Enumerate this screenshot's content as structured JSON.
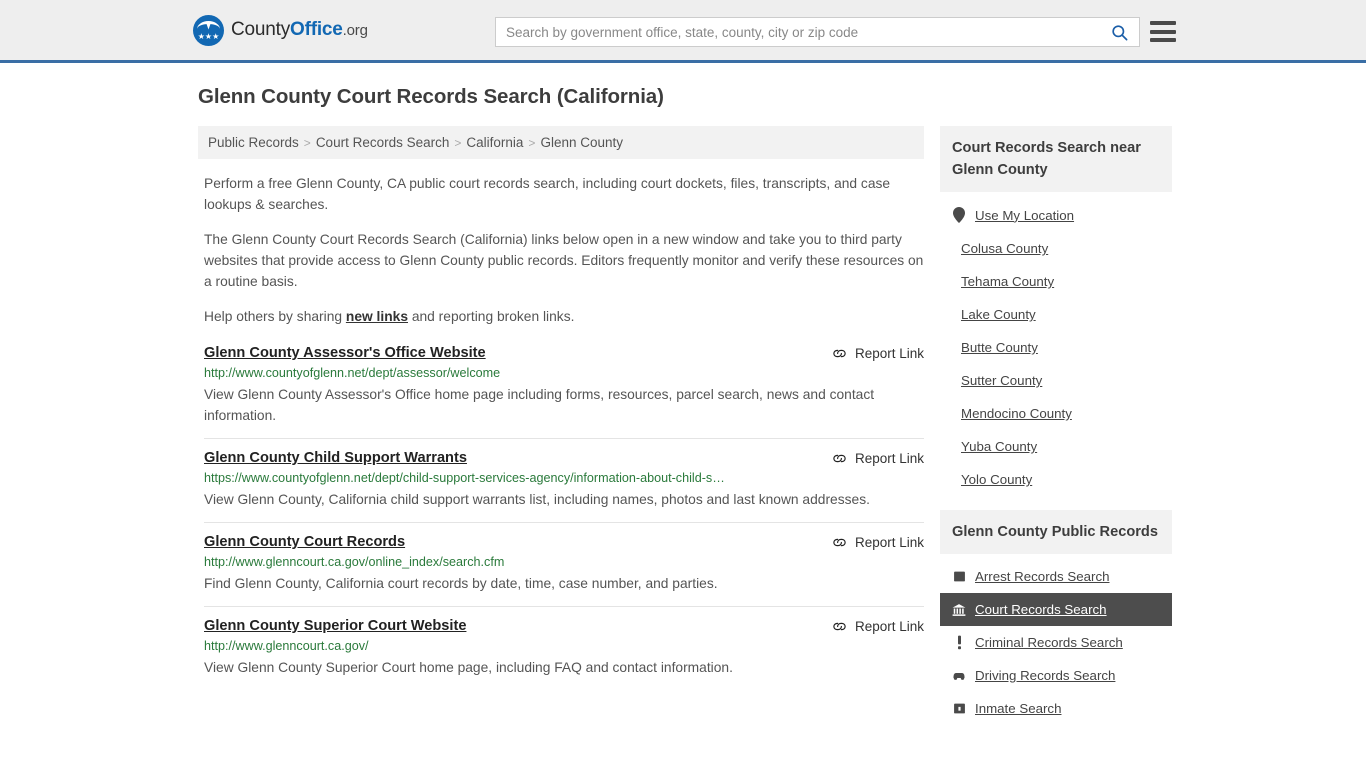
{
  "header": {
    "logo": {
      "text_county": "County",
      "text_office": "Office",
      "text_org": ".org",
      "stars": "★★★"
    },
    "search": {
      "placeholder": "Search by government office, state, county, city or zip code",
      "value": "",
      "icon": "search-icon"
    },
    "menu_icon": "hamburger-menu-icon"
  },
  "page": {
    "title": "Glenn County Court Records Search (California)"
  },
  "breadcrumb": [
    "Public Records",
    "Court Records Search",
    "California",
    "Glenn County"
  ],
  "breadcrumb_separator": ">",
  "intro": {
    "p1": "Perform a free Glenn County, CA public court records search, including court dockets, files, transcripts, and case lookups & searches.",
    "p2": "The Glenn County Court Records Search (California) links below open in a new window and take you to third party websites that provide access to Glenn County public records. Editors frequently monitor and verify these resources on a routine basis.",
    "p3_before": "Help others by sharing ",
    "p3_link": "new links",
    "p3_after": " and reporting broken links."
  },
  "results": {
    "report_label": "Report Link",
    "report_icon": "broken-link-icon",
    "items": [
      {
        "title": "Glenn County Assessor's Office Website",
        "url": "http://www.countyofglenn.net/dept/assessor/welcome",
        "description": "View Glenn County Assessor's Office home page including forms, resources, parcel search, news and contact information."
      },
      {
        "title": "Glenn County Child Support Warrants",
        "url": "https://www.countyofglenn.net/dept/child-support-services-agency/information-about-child-s…",
        "description": "View Glenn County, California child support warrants list, including names, photos and last known addresses."
      },
      {
        "title": "Glenn County Court Records",
        "url": "http://www.glenncourt.ca.gov/online_index/search.cfm",
        "description": "Find Glenn County, California court records by date, time, case number, and parties."
      },
      {
        "title": "Glenn County Superior Court Website",
        "url": "http://www.glenncourt.ca.gov/",
        "description": "View Glenn County Superior Court home page, including FAQ and contact information."
      }
    ]
  },
  "sidebar": {
    "nearby": {
      "title": "Court Records Search near Glenn County",
      "items": [
        {
          "label": "Use My Location",
          "icon": "map-pin-icon",
          "active": false
        },
        {
          "label": "Colusa County",
          "icon": "",
          "active": false
        },
        {
          "label": "Tehama County",
          "icon": "",
          "active": false
        },
        {
          "label": "Lake County",
          "icon": "",
          "active": false
        },
        {
          "label": "Butte County",
          "icon": "",
          "active": false
        },
        {
          "label": "Sutter County",
          "icon": "",
          "active": false
        },
        {
          "label": "Mendocino County",
          "icon": "",
          "active": false
        },
        {
          "label": "Yuba County",
          "icon": "",
          "active": false
        },
        {
          "label": "Yolo County",
          "icon": "",
          "active": false
        }
      ]
    },
    "public_records": {
      "title": "Glenn County Public Records",
      "items": [
        {
          "label": "Arrest Records Search",
          "icon": "fingerprint-icon",
          "active": false
        },
        {
          "label": "Court Records Search",
          "icon": "courthouse-icon",
          "active": true
        },
        {
          "label": "Criminal Records Search",
          "icon": "exclamation-icon",
          "active": false
        },
        {
          "label": "Driving Records Search",
          "icon": "car-icon",
          "active": false
        },
        {
          "label": "Inmate Search",
          "icon": "jail-icon",
          "active": false
        }
      ]
    }
  },
  "colors": {
    "brand_blue": "#1268b3",
    "header_border": "#3a6ea5",
    "url_green": "#2a7a3b",
    "active_bg": "#4d4d4d"
  }
}
